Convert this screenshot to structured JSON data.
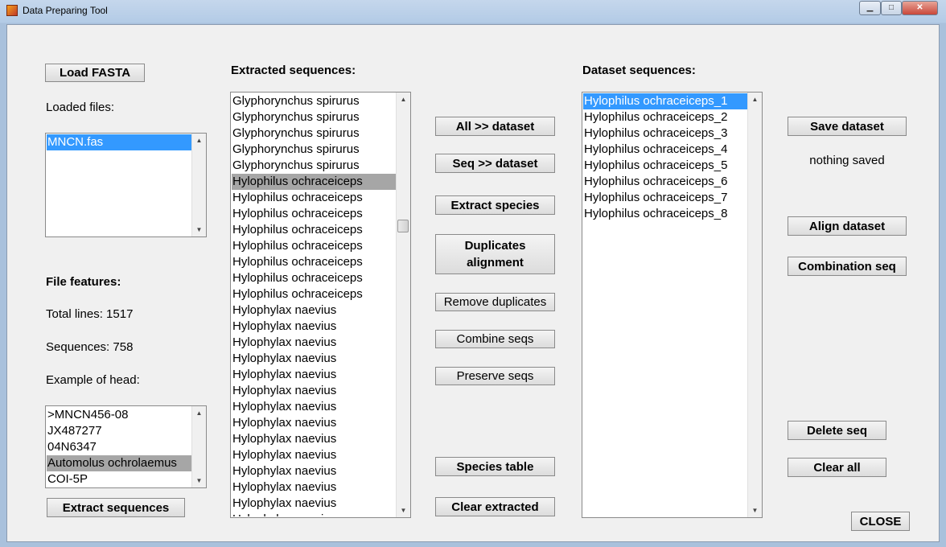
{
  "window": {
    "title": "Data Preparing Tool",
    "minimize_glyph": "▁",
    "maximize_glyph": "□",
    "close_glyph": "✕"
  },
  "left": {
    "load_button": "Load FASTA",
    "loaded_files_label": "Loaded files:",
    "loaded_files": [
      "MNCN.fas"
    ],
    "file_features_label": "File features:",
    "total_lines": "Total lines: 1517",
    "sequences": "Sequences: 758",
    "example_head_label": "Example of head:",
    "head_items": [
      ">MNCN456-08",
      "JX487277",
      "04N6347",
      "Automolus ochrolaemus",
      "COI-5P"
    ],
    "extract_button": "Extract sequences"
  },
  "extracted": {
    "label": "Extracted sequences:",
    "items": [
      "Glyphorynchus spirurus",
      "Glyphorynchus spirurus",
      "Glyphorynchus spirurus",
      "Glyphorynchus spirurus",
      "Glyphorynchus spirurus",
      "Hylophilus ochraceiceps",
      "Hylophilus ochraceiceps",
      "Hylophilus ochraceiceps",
      "Hylophilus ochraceiceps",
      "Hylophilus ochraceiceps",
      "Hylophilus ochraceiceps",
      "Hylophilus ochraceiceps",
      "Hylophilus ochraceiceps",
      "Hylophylax naevius",
      "Hylophylax naevius",
      "Hylophylax naevius",
      "Hylophylax naevius",
      "Hylophylax naevius",
      "Hylophylax naevius",
      "Hylophylax naevius",
      "Hylophylax naevius",
      "Hylophylax naevius",
      "Hylophylax naevius",
      "Hylophylax naevius",
      "Hylophylax naevius",
      "Hylophylax naevius",
      "Hylophylax naevius"
    ]
  },
  "middle": {
    "all_to_dataset": "All >> dataset",
    "seq_to_dataset": "Seq >> dataset",
    "extract_species": "Extract species",
    "duplicates_line1": "Duplicates",
    "duplicates_line2": "alignment",
    "remove_duplicates": "Remove duplicates",
    "combine_seqs": "Combine seqs",
    "preserve_seqs": "Preserve seqs",
    "species_table": "Species table",
    "clear_extracted": "Clear extracted"
  },
  "dataset": {
    "label": "Dataset sequences:",
    "items": [
      "Hylophilus ochraceiceps_1",
      "Hylophilus ochraceiceps_2",
      "Hylophilus ochraceiceps_3",
      "Hylophilus ochraceiceps_4",
      "Hylophilus ochraceiceps_5",
      "Hylophilus ochraceiceps_6",
      "Hylophilus ochraceiceps_7",
      "Hylophilus ochraceiceps_8"
    ]
  },
  "right": {
    "save_dataset": "Save dataset",
    "status": "nothing saved",
    "align_dataset": "Align dataset",
    "combination_seq": "Combination seq",
    "delete_seq": "Delete seq",
    "clear_all": "Clear all",
    "close": "CLOSE"
  },
  "colors": {
    "selection_blue": "#3399ff",
    "selection_gray": "#a6a6a6",
    "panel_background": "#f0f0f0"
  }
}
